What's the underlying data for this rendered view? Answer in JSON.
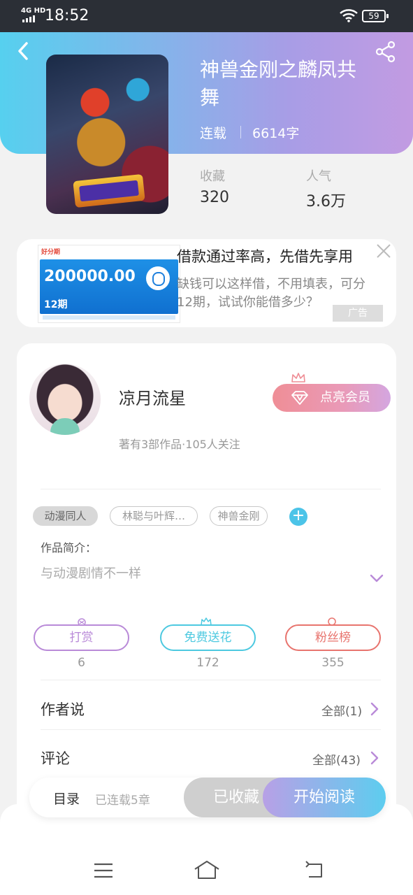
{
  "status_bar": {
    "network": "4G HD",
    "time": "18:52",
    "battery": "59"
  },
  "book": {
    "title": "神兽金刚之麟凤共舞",
    "status": "连载",
    "word_count": "6614字",
    "stats": [
      {
        "label": "收藏",
        "value": "320"
      },
      {
        "label": "人气",
        "value": "3.6万"
      }
    ]
  },
  "ad": {
    "brand": "好分期",
    "amount": "200000.00",
    "period": "12期",
    "title": "借款通过率高，先借先享用",
    "description": "缺钱可以这样借，不用填表，可分12期，试试你能借多少？",
    "tag": "广告"
  },
  "author": {
    "name": "凉月流星",
    "stats": "著有3部作品·105人关注",
    "member_button": "点亮会员"
  },
  "tags": [
    "动漫同人",
    "林聪与叶辉…",
    "神兽金刚"
  ],
  "intro": {
    "label": "作品简介：",
    "text": "与动漫剧情不一样"
  },
  "actions": [
    {
      "label": "打赏",
      "count": "6",
      "color": "#b98ad8"
    },
    {
      "label": "免费送花",
      "count": "172",
      "color": "#4dc9e0"
    },
    {
      "label": "粉丝榜",
      "count": "355",
      "color": "#e8746e"
    }
  ],
  "rows": [
    {
      "title": "作者说",
      "link": "全部(1)"
    },
    {
      "title": "评论",
      "link": "全部(43)"
    }
  ],
  "bottom_bar": {
    "toc": "目录",
    "toc_sub": "已连载5章",
    "favorited": "已收藏",
    "start_reading": "开始阅读"
  },
  "colors": {
    "accent_purple": "#b98ad8",
    "accent_cyan": "#4dc9e0",
    "accent_red": "#e8746e"
  }
}
